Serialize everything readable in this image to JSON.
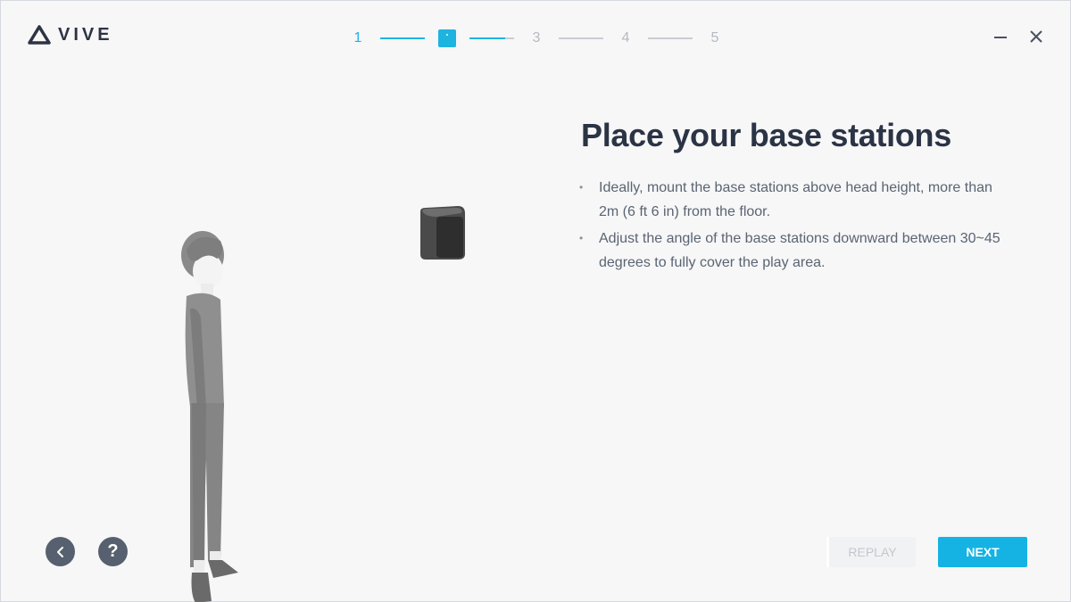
{
  "header": {
    "logo_text": "VIVE",
    "steps": [
      "1",
      "2",
      "3",
      "4",
      "5"
    ],
    "current_step": 2
  },
  "window": {
    "minimize_icon": "minimize-icon",
    "close_icon": "close-icon"
  },
  "main": {
    "title": "Place your base stations",
    "bullets": [
      "Ideally, mount the base stations above head height, more than 2m (6 ft 6 in) from the floor.",
      "Adjust the angle of the base stations downward between 30~45 degrees to fully cover the play area."
    ]
  },
  "footer": {
    "back_icon": "chevron-left-icon",
    "help_label": "?",
    "replay_label": "REPLAY",
    "next_label": "NEXT"
  },
  "colors": {
    "accent": "#14b3e4",
    "text_dark": "#2b3445",
    "text_body": "#5a6472",
    "background": "#f7f7f8"
  }
}
